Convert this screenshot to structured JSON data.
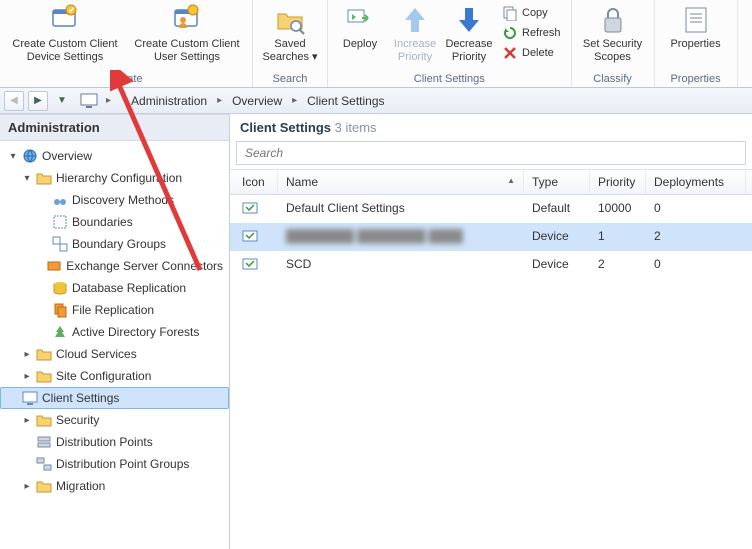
{
  "ribbon": {
    "groups": {
      "create": {
        "title": "Create",
        "btn_device": "Create Custom Client Device Settings",
        "btn_user": "Create Custom Client User Settings"
      },
      "search": {
        "title": "Search",
        "btn_saved": "Saved Searches ▾"
      },
      "client_settings": {
        "title": "Client Settings",
        "btn_deploy": "Deploy",
        "btn_increase": "Increase Priority",
        "btn_decrease": "Decrease Priority",
        "btn_copy": "Copy",
        "btn_refresh": "Refresh",
        "btn_delete": "Delete"
      },
      "classify": {
        "title": "Classify",
        "btn_scopes": "Set Security Scopes"
      },
      "properties": {
        "title": "Properties",
        "btn_props": "Properties"
      }
    }
  },
  "breadcrumbs": {
    "items": [
      "Administration",
      "Overview",
      "Client Settings"
    ]
  },
  "sidebar": {
    "title": "Administration",
    "nodes": {
      "overview": "Overview",
      "hierarchy": "Hierarchy Configuration",
      "discovery": "Discovery Methods",
      "boundaries": "Boundaries",
      "boundary_groups": "Boundary Groups",
      "exchange": "Exchange Server Connectors",
      "db_repl": "Database Replication",
      "file_repl": "File Replication",
      "ad_forests": "Active Directory Forests",
      "cloud": "Cloud Services",
      "site_cfg": "Site Configuration",
      "client_settings": "Client Settings",
      "security": "Security",
      "dist_points": "Distribution Points",
      "dist_groups": "Distribution Point Groups",
      "migration": "Migration"
    }
  },
  "content": {
    "heading_label": "Client Settings",
    "heading_count": "3 items",
    "search_placeholder": "Search",
    "columns": {
      "icon": "Icon",
      "name": "Name",
      "type": "Type",
      "priority": "Priority",
      "deploy": "Deployments"
    },
    "rows": [
      {
        "name": "Default Client Settings",
        "type": "Default",
        "priority": "10000",
        "deploy": "0",
        "selected": false,
        "blurred": false
      },
      {
        "name": "████████ ████████ ████",
        "type": "Device",
        "priority": "1",
        "deploy": "2",
        "selected": true,
        "blurred": true
      },
      {
        "name": "SCD",
        "type": "Device",
        "priority": "2",
        "deploy": "0",
        "selected": false,
        "blurred": false
      }
    ]
  }
}
